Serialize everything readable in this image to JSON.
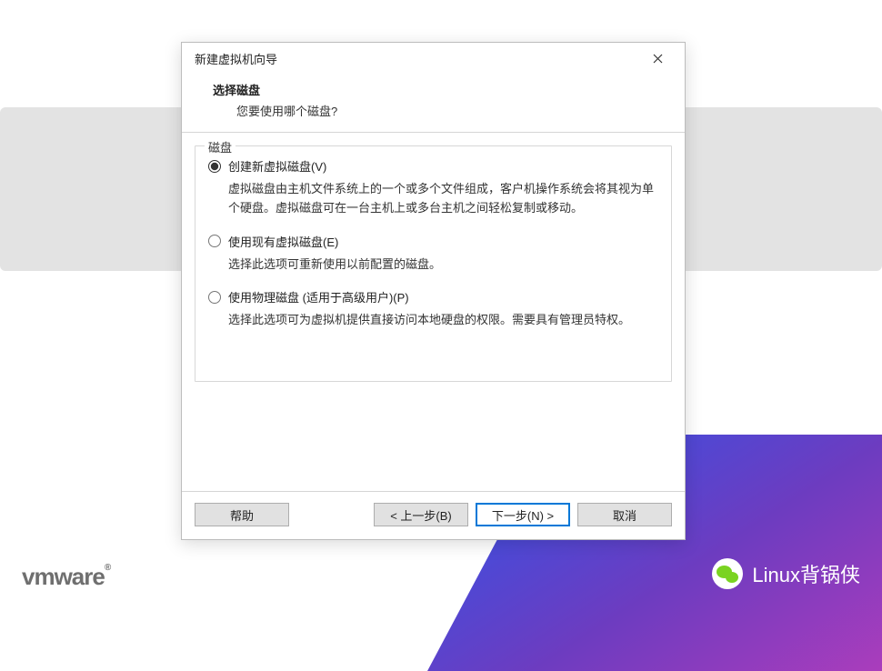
{
  "dialog": {
    "title": "新建虚拟机向导",
    "heading": "选择磁盘",
    "subheading": "您要使用哪个磁盘?"
  },
  "fieldset": {
    "legend": "磁盘"
  },
  "options": {
    "create": {
      "label": "创建新虚拟磁盘(V)",
      "desc": "虚拟磁盘由主机文件系统上的一个或多个文件组成，客户机操作系统会将其视为单个硬盘。虚拟磁盘可在一台主机上或多台主机之间轻松复制或移动。"
    },
    "existing": {
      "label": "使用现有虚拟磁盘(E)",
      "desc": "选择此选项可重新使用以前配置的磁盘。"
    },
    "physical": {
      "label": "使用物理磁盘 (适用于高级用户)(P)",
      "desc": "选择此选项可为虚拟机提供直接访问本地硬盘的权限。需要具有管理员特权。"
    }
  },
  "buttons": {
    "help": "帮助",
    "back": "< 上一步(B)",
    "next": "下一步(N) >",
    "cancel": "取消"
  },
  "branding": {
    "vmware": "vmware",
    "wechat_text": "Linux背锅侠"
  }
}
